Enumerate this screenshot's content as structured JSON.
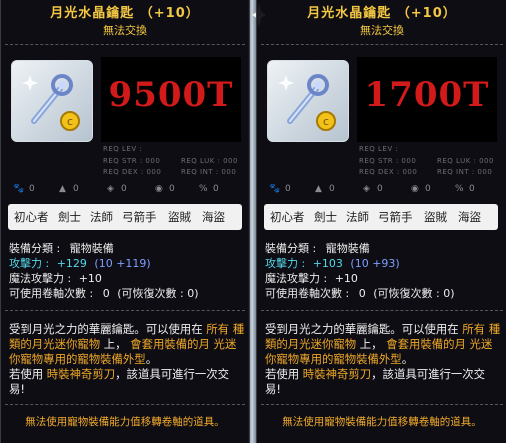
{
  "tooltips": [
    {
      "title": "月光水晶鑰匙 （+10）",
      "subtitle": "無法交換",
      "price_overlay": "9500T",
      "req": {
        "lev": "REQ LEV :",
        "str": "REQ STR : 000",
        "luk": "REQ LUK : 000",
        "dex": "REQ DEX : 000",
        "int": "REQ INT : 000"
      },
      "glyph_vals": [
        "0",
        "0",
        "0",
        "0",
        "0"
      ],
      "jobs": [
        "初心者",
        "劍士",
        "法師",
        "弓箭手",
        "盜賊",
        "海盜"
      ],
      "category_label": "裝備分類 :",
      "category_value": "寵物裝備",
      "atk_label": "攻擊力 :",
      "atk_value": "+129",
      "atk_bonus": "(10 +119)",
      "matk_label": "魔法攻擊力 :",
      "matk_value": "+10",
      "scroll_label": "可使用卷軸次數 :",
      "scroll_value": "0",
      "scroll_restore": "(可恢復次數 : 0)",
      "desc_1": "受到月光之力的華麗鑰匙。可以使用在",
      "desc_hl_1": "所有",
      "desc_hl_2": "種類的月光迷你寵物",
      "desc_2": "上， ",
      "desc_hl_3": "會套用裝備的月",
      "desc_hl_4": "光迷你寵物專用的寵物裝備外型",
      "desc_3": "。",
      "desc_4": "若使用 ",
      "desc_hl_5": "時裝神奇剪刀",
      "desc_5": "，該道具可進行一次交易!",
      "footer": "無法使用寵物裝備能力值移轉卷軸的道具。"
    },
    {
      "title": "月光水晶鑰匙 （+10）",
      "subtitle": "無法交換",
      "price_overlay": "1700T",
      "req": {
        "lev": "REQ LEV :",
        "str": "REQ STR : 000",
        "luk": "REQ LUK : 000",
        "dex": "REQ DEX : 000",
        "int": "REQ INT : 000"
      },
      "glyph_vals": [
        "0",
        "0",
        "0",
        "0",
        "0"
      ],
      "jobs": [
        "初心者",
        "劍士",
        "法師",
        "弓箭手",
        "盜賊",
        "海盜"
      ],
      "category_label": "裝備分類 :",
      "category_value": "寵物裝備",
      "atk_label": "攻擊力 :",
      "atk_value": "+103",
      "atk_bonus": "(10 +93)",
      "matk_label": "魔法攻擊力 :",
      "matk_value": "+10",
      "scroll_label": "可使用卷軸次數 :",
      "scroll_value": "0",
      "scroll_restore": "(可恢復次數 : 0)",
      "desc_1": "受到月光之力的華麗鑰匙。可以使用在",
      "desc_hl_1": "所有",
      "desc_hl_2": "種類的月光迷你寵物",
      "desc_2": "上， ",
      "desc_hl_3": "會套用裝備的月",
      "desc_hl_4": "光迷你寵物專用的寵物裝備外型",
      "desc_3": "。",
      "desc_4": "若使用 ",
      "desc_hl_5": "時裝神奇剪刀",
      "desc_5": "，該道具可進行一次交易!",
      "footer": "無法使用寵物裝備能力值移轉卷軸的道具。"
    }
  ],
  "icons": {
    "item": "moon-crystal-key-icon",
    "badge": "gold-coin-badge-icon",
    "glyphs": [
      "pet-icon",
      "upload-icon",
      "shield-icon",
      "potion-icon",
      "percent-icon"
    ]
  },
  "colors": {
    "title": "#f4c842",
    "price_overlay": "#d21a1a",
    "highlight": "#f0a828",
    "stat_cyan": "#54d8e8",
    "stat_blue": "#7ea0ff"
  }
}
